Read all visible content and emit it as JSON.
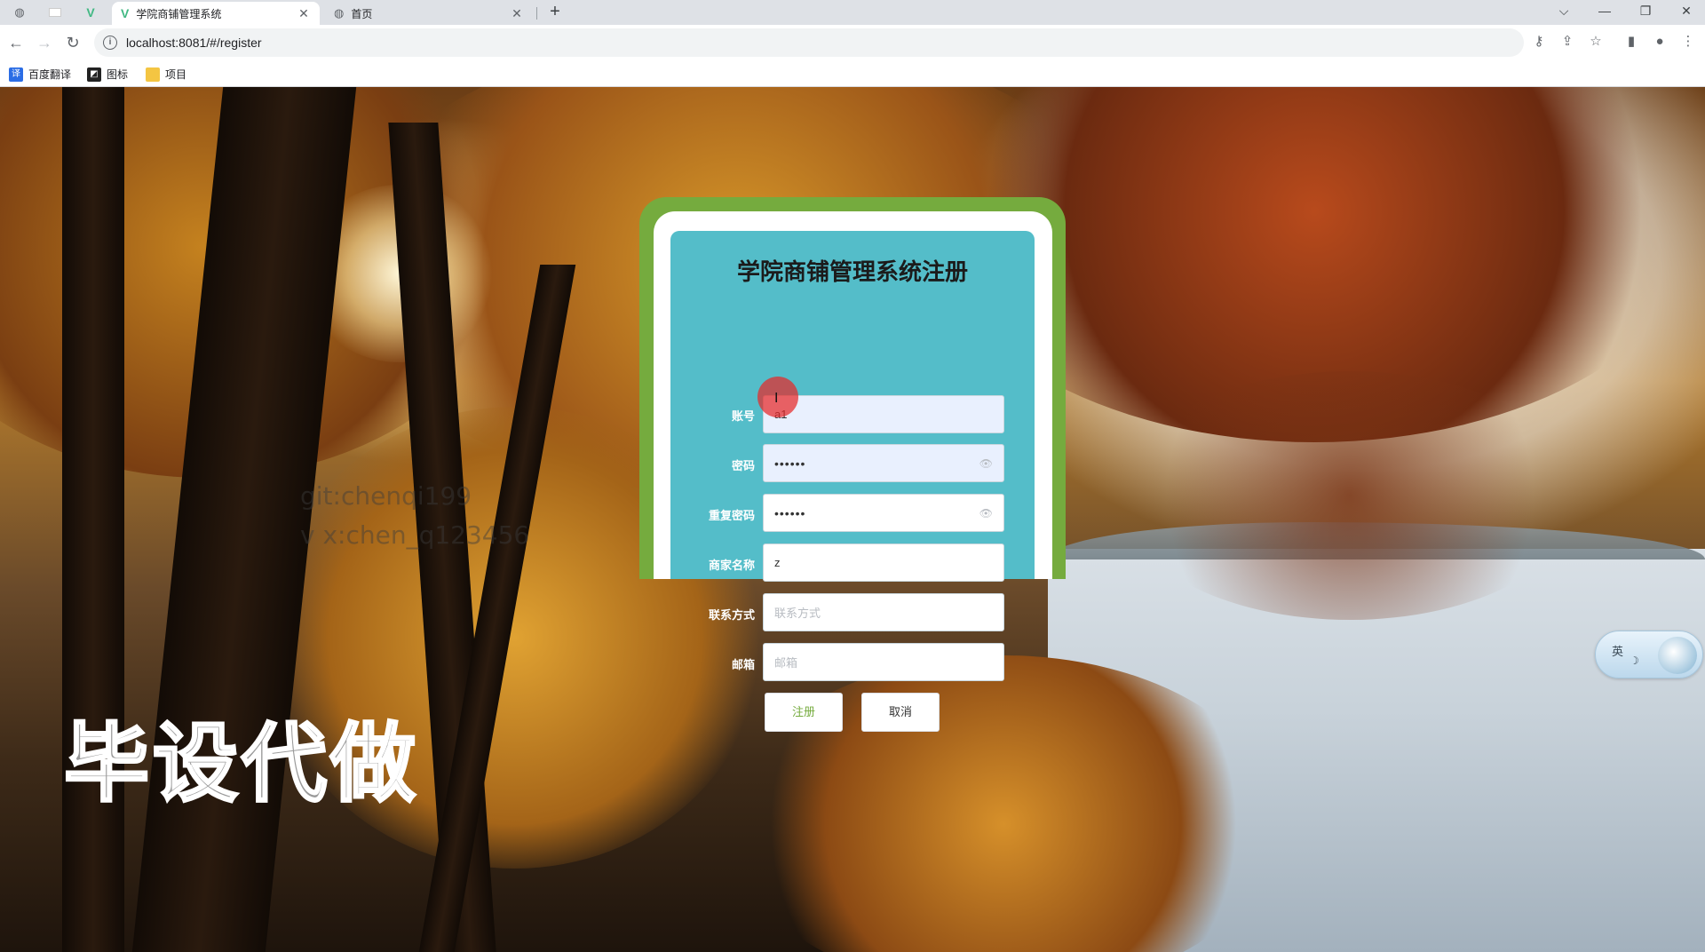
{
  "browser": {
    "tabs": [
      {
        "title": "学院商铺管理系统",
        "close": "✕",
        "active": true
      },
      {
        "title": "首页",
        "close": "✕",
        "active": false
      }
    ],
    "new_tab": "+",
    "url": "localhost:8081/#/register",
    "info_icon": "i",
    "window_controls": {
      "dropdown": "⌵",
      "minimize": "—",
      "restore": "❐",
      "close": "✕"
    },
    "nav": {
      "back": "←",
      "forward": "→",
      "reload": "↻"
    },
    "toolbar_icons": {
      "key": "⚷",
      "share": "⇪",
      "star": "☆",
      "sidepanel": "▮",
      "profile": "●",
      "menu": "⋮"
    },
    "bookmarks": [
      {
        "label": "百度翻译",
        "icon": "译",
        "color": "#2b6de5"
      },
      {
        "label": "图标",
        "icon": "◩",
        "color": "#222222"
      },
      {
        "label": "项目",
        "icon": "",
        "color": "#f4c542"
      }
    ]
  },
  "watermarks": {
    "line1": "git:chenqi199",
    "line2": "v x:chen_q123456",
    "banner": "毕设代做"
  },
  "form": {
    "title": "学院商铺管理系统注册",
    "fields": [
      {
        "label": "账号",
        "value": "a1",
        "placeholder": "",
        "type": "text"
      },
      {
        "label": "密码",
        "value": "••••••",
        "placeholder": "",
        "type": "password"
      },
      {
        "label": "重复密码",
        "value": "••••••",
        "placeholder": "",
        "type": "password"
      },
      {
        "label": "商家名称",
        "value": "z",
        "placeholder": "",
        "type": "text"
      },
      {
        "label": "联系方式",
        "value": "",
        "placeholder": "联系方式",
        "type": "text"
      },
      {
        "label": "邮箱",
        "value": "",
        "placeholder": "邮箱",
        "type": "text"
      }
    ],
    "eye_icon": "👁",
    "register_button": "注册",
    "cancel_button": "取消"
  },
  "ime": {
    "lang": "英",
    "moon": "☽"
  },
  "cursor": "I",
  "colors": {
    "accent_green": "#75ab3e",
    "card_teal": "#54bdc9"
  }
}
